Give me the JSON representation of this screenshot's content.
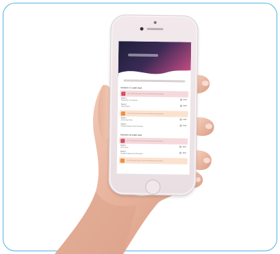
{
  "image": {
    "description_icons": [
      "hand-icon",
      "phone-icon"
    ],
    "colors": {
      "frame_border": "#4fb2e3",
      "phone_body": "#ece3e6",
      "hero_gradient_start": "#1d1f3a",
      "hero_gradient_end": "#d9508a",
      "note_red": "#d3495b",
      "note_orange": "#ee8a3f"
    }
  },
  "screen": {
    "sections": [
      {
        "title": "MONDAY 27 JUNE 2022",
        "items": [
          {
            "kind": "note",
            "tone": "red",
            "badge": "!",
            "text": "We noticed you have not yet submitted your job update"
          },
          {
            "kind": "row",
            "label": "Break 1",
            "sub": "Rotate Bin Truck Route",
            "value": "$200"
          },
          {
            "kind": "row",
            "label": "Break 2",
            "sub": "Shop Round",
            "value": "$200"
          },
          {
            "kind": "note",
            "tone": "orange",
            "badge": "!",
            "text": "We noticed you have not yet submitted your job update"
          },
          {
            "kind": "row",
            "label": "Break 1",
            "sub": "Event Store Run",
            "value": "$200"
          },
          {
            "kind": "row",
            "label": "Break 2",
            "sub": "Outside Prepare And Pick Items",
            "value": "$200"
          }
        ]
      },
      {
        "title": "TUESDAY 28 JUNE 2022",
        "items": [
          {
            "kind": "note",
            "tone": "red",
            "badge": "!",
            "text": "We noticed you have not yet submitted your job update"
          },
          {
            "kind": "row",
            "label": "Break 1",
            "sub": "Shop Drive",
            "value": "$200"
          },
          {
            "kind": "row",
            "label": "Break 2",
            "sub": "Outside Prepare And Pick Items",
            "value": "$200"
          },
          {
            "kind": "note",
            "tone": "orange",
            "badge": "!",
            "text": "We noticed you have not yet submitted your job update"
          }
        ]
      }
    ]
  }
}
